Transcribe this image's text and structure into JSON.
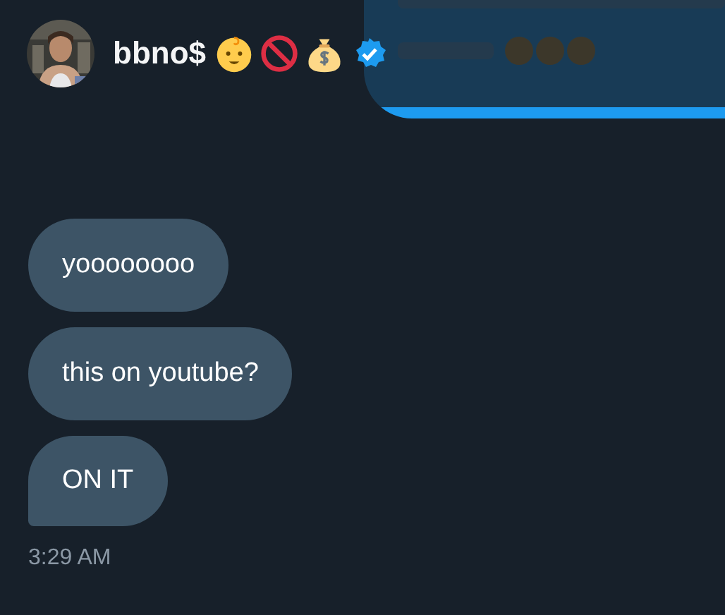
{
  "header": {
    "name": "bbno$",
    "verified": true
  },
  "messages": [
    {
      "text": "yoooooooo",
      "tail": false
    },
    {
      "text": "this on youtube?",
      "tail": false
    },
    {
      "text": "ON IT",
      "tail": true
    }
  ],
  "timestamp": "3:29 AM"
}
